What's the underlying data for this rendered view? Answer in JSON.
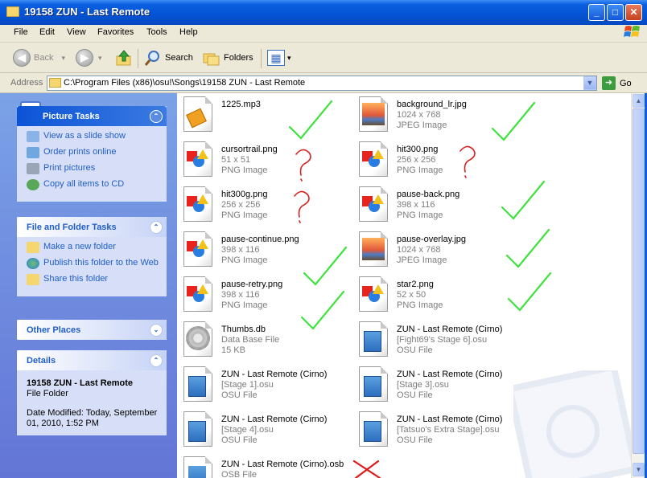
{
  "window": {
    "title": "19158 ZUN - Last Remote",
    "minimize_glyph": "_",
    "maximize_glyph": "□",
    "close_glyph": "✕"
  },
  "menu": [
    "File",
    "Edit",
    "View",
    "Favorites",
    "Tools",
    "Help"
  ],
  "toolbar": {
    "back": "Back",
    "back_glyph": "◀",
    "forward_glyph": "▶",
    "search": "Search",
    "folders": "Folders",
    "dropdown_glyph": "▾",
    "dropdown_glyph2": "▾",
    "view_glyph": "▦"
  },
  "address": {
    "label": "Address",
    "path": "C:\\Program Files (x86)\\osu!\\Songs\\19158 ZUN - Last Remote",
    "dropdown_glyph": "▼",
    "go_arrow": "➜",
    "go": "Go"
  },
  "sidebar": {
    "picture_tasks": {
      "title": "Picture Tasks",
      "items": [
        "View as a slide show",
        "Order prints online",
        "Print pictures",
        "Copy all items to CD"
      ]
    },
    "file_folder_tasks": {
      "title": "File and Folder Tasks",
      "items": [
        "Make a new folder",
        "Publish this folder to the Web",
        "Share this folder"
      ]
    },
    "other_places": {
      "title": "Other Places"
    },
    "details": {
      "title": "Details",
      "name": "19158 ZUN - Last Remote",
      "type": "File Folder",
      "modified": "Date Modified: Today, September 01, 2010, 1:52 PM"
    },
    "chevron_up": "⌃",
    "chevron_down": "⌄"
  },
  "files": [
    {
      "name": "1225.mp3",
      "line2": "",
      "line3": "",
      "icon": "mp3-icon"
    },
    {
      "name": "background_lr.jpg",
      "line2": "1024 x 768",
      "line3": "JPEG Image",
      "icon": "jpeg-image-icon"
    },
    {
      "name": "cursortrail.png",
      "line2": "51 x 51",
      "line3": "PNG Image",
      "icon": "png-image-icon"
    },
    {
      "name": "hit300.png",
      "line2": "256 x 256",
      "line3": "PNG Image",
      "icon": "png-image-icon"
    },
    {
      "name": "hit300g.png",
      "line2": "256 x 256",
      "line3": "PNG Image",
      "icon": "png-image-icon"
    },
    {
      "name": "pause-back.png",
      "line2": "398 x 116",
      "line3": "PNG Image",
      "icon": "png-image-icon"
    },
    {
      "name": "pause-continue.png",
      "line2": "398 x 116",
      "line3": "PNG Image",
      "icon": "png-image-icon"
    },
    {
      "name": "pause-overlay.jpg",
      "line2": "1024 x 768",
      "line3": "JPEG Image",
      "icon": "jpeg-image-icon"
    },
    {
      "name": "pause-retry.png",
      "line2": "398 x 116",
      "line3": "PNG Image",
      "icon": "png-image-icon"
    },
    {
      "name": "star2.png",
      "line2": "52 x 50",
      "line3": "PNG Image",
      "icon": "png-image-icon"
    },
    {
      "name": "Thumbs.db",
      "line2": "Data Base File",
      "line3": "15 KB",
      "icon": "database-file-icon"
    },
    {
      "name": "ZUN - Last Remote (Cirno)",
      "line2": "[Fight69's Stage 6].osu",
      "line3": "OSU File",
      "icon": "osu-file-icon"
    },
    {
      "name": "ZUN - Last Remote (Cirno)",
      "line2": "[Stage 1].osu",
      "line3": "OSU File",
      "icon": "osu-file-icon"
    },
    {
      "name": "ZUN - Last Remote (Cirno)",
      "line2": "[Stage 3].osu",
      "line3": "OSU File",
      "icon": "osu-file-icon"
    },
    {
      "name": "ZUN - Last Remote (Cirno)",
      "line2": "[Stage 4].osu",
      "line3": "OSU File",
      "icon": "osu-file-icon"
    },
    {
      "name": "ZUN - Last Remote (Cirno)",
      "line2": "[Tatsuo's Extra Stage].osu",
      "line3": "OSU File",
      "icon": "osu-file-icon"
    },
    {
      "name": "ZUN - Last Remote (Cirno).osb",
      "line2": "OSB File",
      "line3": "",
      "icon": "osb-file-icon"
    }
  ],
  "annotations": {
    "check_color": "#3ee23e",
    "question_color": "#d42020",
    "cross_color": "#e01818"
  },
  "scrollbar": {
    "up_glyph": "▲",
    "down_glyph": "▼"
  }
}
